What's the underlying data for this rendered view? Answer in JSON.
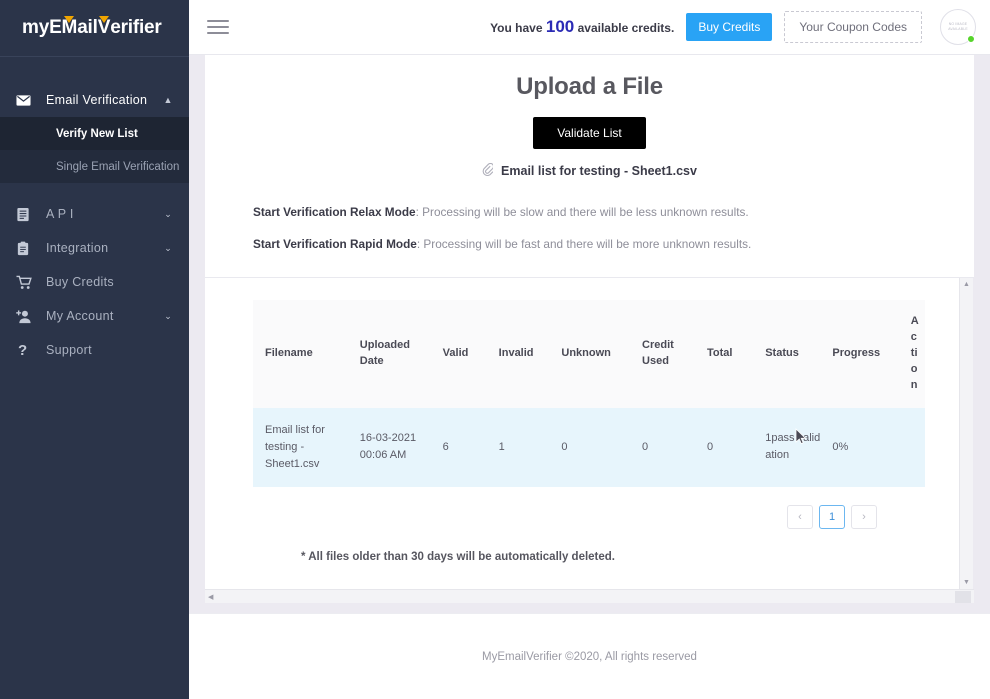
{
  "sidebar": {
    "logo": "myEMailVerifier",
    "items": [
      {
        "label": "Email Verification",
        "icon": "envelope-icon",
        "caret": "▲",
        "active": true
      },
      {
        "label": "A P I",
        "icon": "list-icon",
        "caret": "⌄",
        "active": false
      },
      {
        "label": "Integration",
        "icon": "clipboard-icon",
        "caret": "⌄",
        "active": false
      },
      {
        "label": "Buy Credits",
        "icon": "cart-icon",
        "caret": "",
        "active": false
      },
      {
        "label": "My Account",
        "icon": "user-plus-icon",
        "caret": "⌄",
        "active": false
      },
      {
        "label": "Support",
        "icon": "question-icon",
        "caret": "",
        "active": false
      }
    ],
    "subitems": [
      {
        "label": "Verify New List",
        "selected": true
      },
      {
        "label": "Single Email Verification",
        "selected": false
      }
    ]
  },
  "topbar": {
    "menu_icon": "hamburger-icon",
    "credits_prefix": "You have",
    "credits_count": "100",
    "credits_suffix": "available credits.",
    "buy_credits_label": "Buy Credits",
    "coupon_label": "Your Coupon Codes",
    "avatar_text": "NO IMAGE AVAILABLE",
    "status": "online",
    "accent_blue": "#29a3f5",
    "credits_number_color": "#2b2bb5"
  },
  "main": {
    "title": "Upload a File",
    "validate_button": "Validate List",
    "file_name": "Email list for testing - Sheet1.csv",
    "attachment_icon": "paperclip-icon",
    "modes": [
      {
        "label": "Start Verification Relax Mode",
        "desc": ": Processing will be slow and there will be less unknown results."
      },
      {
        "label": "Start Verification Rapid Mode",
        "desc": ": Processing will be fast and there will be more unknown results."
      }
    ],
    "table": {
      "headers": [
        "Filename",
        "Uploaded Date",
        "Valid",
        "Invalid",
        "Unknown",
        "Credit Used",
        "Total",
        "Status",
        "Progress",
        "Action"
      ],
      "rows": [
        {
          "filename": "Email list for testing - Sheet1.csv",
          "uploaded_date": "16-03-2021 00:06 AM",
          "valid": "6",
          "invalid": "1",
          "unknown": "0",
          "credit_used": "0",
          "total": "0",
          "status": "1pass validation",
          "progress": "0%",
          "action": ""
        }
      ]
    },
    "pagination": {
      "prev": "‹",
      "pages": [
        "1"
      ],
      "next": "›",
      "current": "1"
    },
    "note": "* All files older than 30 days will be automatically deleted."
  },
  "footer": {
    "text": "MyEmailVerifier ©2020, All rights reserved"
  }
}
